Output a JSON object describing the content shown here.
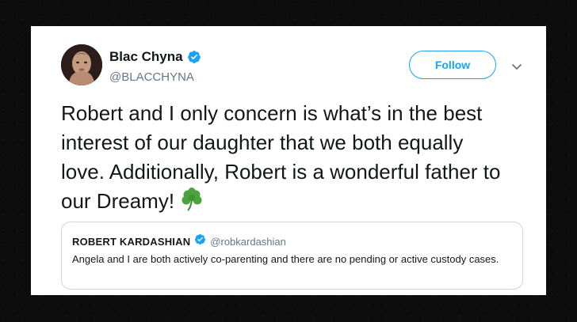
{
  "tweet": {
    "author_name": "Blac Chyna",
    "author_handle": "@BLACCHYNA",
    "follow_label": "Follow",
    "text": "Robert and I only concern is what’s in the best interest of our daughter that we both equally love. Additionally, Robert is a wonderful father to our Dreamy!",
    "emoji": "☘️"
  },
  "quoted_tweet": {
    "author_name": "ROBERT KARDASHIAN",
    "author_handle": "@robkardashian",
    "text": "Angela and I are both actively co-parenting and there are no pending or active custody cases."
  },
  "colors": {
    "accent": "#1da1f2",
    "text": "#14171a",
    "muted": "#657786",
    "background": "#0d0d0d"
  },
  "icons": {
    "verified": "verified-badge-icon",
    "caret": "chevron-down-icon",
    "emoji": "shamrock-icon"
  }
}
